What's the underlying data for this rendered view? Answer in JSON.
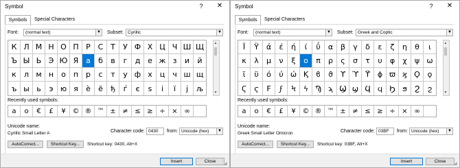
{
  "dialogs": [
    {
      "title": "Symbol",
      "help": "?",
      "close": "✕",
      "tabs": [
        "Symbols",
        "Special Characters"
      ],
      "font_label": "Font:",
      "font_value": "(normal text)",
      "subset_label": "Subset:",
      "subset_value": "Cyrillic",
      "grid": [
        [
          "К",
          "Л",
          "М",
          "Н",
          "О",
          "П",
          "Р",
          "С",
          "Т",
          "У",
          "Ф",
          "Х",
          "Ц",
          "Ч",
          "Ш",
          "Щ"
        ],
        [
          "Ъ",
          "Ы",
          "Ь",
          "Э",
          "Ю",
          "Я",
          "а",
          "б",
          "в",
          "г",
          "д",
          "е",
          "ж",
          "з",
          "и",
          "й"
        ],
        [
          "к",
          "л",
          "м",
          "н",
          "о",
          "п",
          "р",
          "с",
          "т",
          "у",
          "ф",
          "х",
          "ц",
          "ч",
          "ш",
          "щ"
        ],
        [
          "ъ",
          "ы",
          "ь",
          "э",
          "ю",
          "я",
          "ѐ",
          "ё",
          "ђ",
          "ѓ",
          "є",
          "ѕ",
          "і",
          "ї",
          "ј",
          "љ"
        ]
      ],
      "selected": {
        "row": 1,
        "col": 6
      },
      "recent_label": "Recently used symbols:",
      "recent": [
        "а",
        "о",
        "€",
        "£",
        "¥",
        "©",
        "®",
        "™",
        "±",
        "≠",
        "≤",
        "≥",
        "÷",
        "×",
        "∞",
        ""
      ],
      "unicode_name_label": "Unicode name:",
      "unicode_name": "Cyrillic Small Letter A",
      "char_code_label": "Character code:",
      "char_code": "0430",
      "from_label": "from:",
      "from_value": "Unicode (hex)",
      "autocorrect_label": "AutoCorrect...",
      "shortcut_key_label": "Shortcut Key...",
      "shortcut_info": "Shortcut key: 0430, Alt+X",
      "insert_label": "Insert",
      "close_label": "Close"
    },
    {
      "title": "Symbol",
      "help": "?",
      "close": "✕",
      "tabs": [
        "Symbols",
        "Special Characters"
      ],
      "font_label": "Font:",
      "font_value": "(normal text)",
      "subset_label": "Subset:",
      "subset_value": "Greek and Coptic",
      "grid": [
        [
          "Ϊ",
          "Ϋ",
          "ά",
          "έ",
          "ή",
          "ί",
          "ΰ",
          "α",
          "β",
          "γ",
          "δ",
          "ε",
          "ζ",
          "η",
          "θ",
          "ι"
        ],
        [
          "κ",
          "λ",
          "μ",
          "ν",
          "ξ",
          "ο",
          "π",
          "ρ",
          "ς",
          "σ",
          "τ",
          "υ",
          "φ",
          "χ",
          "ψ",
          "ω"
        ],
        [
          "ϊ",
          "ϋ",
          "ό",
          "ύ",
          "ώ",
          "Ϗ",
          "ϐ",
          "ϑ",
          "ϒ",
          "ϓ",
          "ϔ",
          "ϕ",
          "ϖ",
          "ϗ",
          "Ϙ",
          "ϙ"
        ],
        [
          "Ϛ",
          "ϛ",
          "Ϝ",
          "ϝ",
          "Ϟ",
          "ϟ",
          "Ϡ",
          "ϡ",
          "Ϣ",
          "ϣ",
          "Ϥ",
          "ϥ",
          "Ϧ",
          "ϧ",
          "Ϩ",
          "ϩ"
        ]
      ],
      "selected": {
        "row": 1,
        "col": 5
      },
      "recent_label": "Recently used symbols:",
      "recent": [
        "а",
        "о",
        "€",
        "£",
        "¥",
        "©",
        "®",
        "™",
        "±",
        "≠",
        "≤",
        "≥",
        "÷",
        "×",
        "∞",
        ""
      ],
      "unicode_name_label": "Unicode name:",
      "unicode_name": "Greek Small Letter Omicron",
      "char_code_label": "Character code:",
      "char_code": "03BF",
      "from_label": "from:",
      "from_value": "Unicode (hex)",
      "autocorrect_label": "AutoCorrect...",
      "shortcut_key_label": "Shortcut Key...",
      "shortcut_info": "Shortcut key: 03BF, Alt+X",
      "insert_label": "Insert",
      "close_label": "Close"
    }
  ]
}
